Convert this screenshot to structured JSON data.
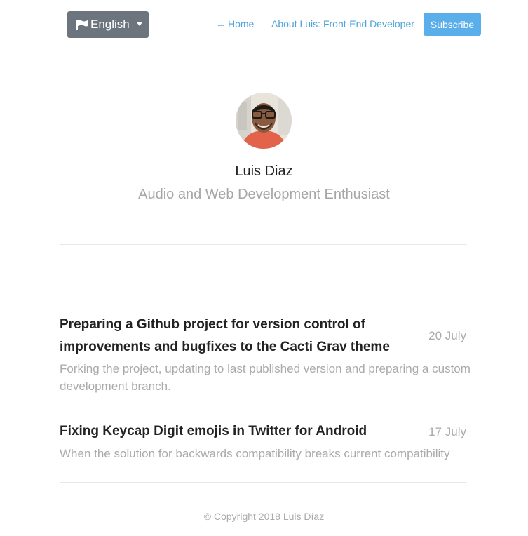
{
  "nav": {
    "language_label": "English",
    "home_label": "Home",
    "about_label": "About Luis: Front-End Developer",
    "subscribe_label": "Subscribe",
    "icons": [
      "flag-icon",
      "caret-down-icon",
      "left-arrow-icon"
    ]
  },
  "profile": {
    "name": "Luis Diaz",
    "tagline": "Audio and Web Development Enthusiast"
  },
  "posts": [
    {
      "title_line1": "Preparing a Github project for version control of",
      "title_line2": "improvements and bugfixes to the Cacti Grav theme",
      "date": "20 July",
      "desc_line1": "Forking the project, updating to last published version and preparing a custom",
      "desc_line2": "development branch."
    },
    {
      "title_line1": "Fixing Keycap Digit emojis in Twitter for Android",
      "date": "17 July",
      "desc_line1": "When the solution for backwards compatibility breaks current compatibility"
    }
  ],
  "footer": {
    "copyright": "© Copyright 2018 Luis Díaz"
  },
  "colors": {
    "accent": "#4ea3dc",
    "subscribe_bg": "#5aaeea",
    "language_bg": "#6c757d",
    "muted_text": "#aaaaaa"
  }
}
